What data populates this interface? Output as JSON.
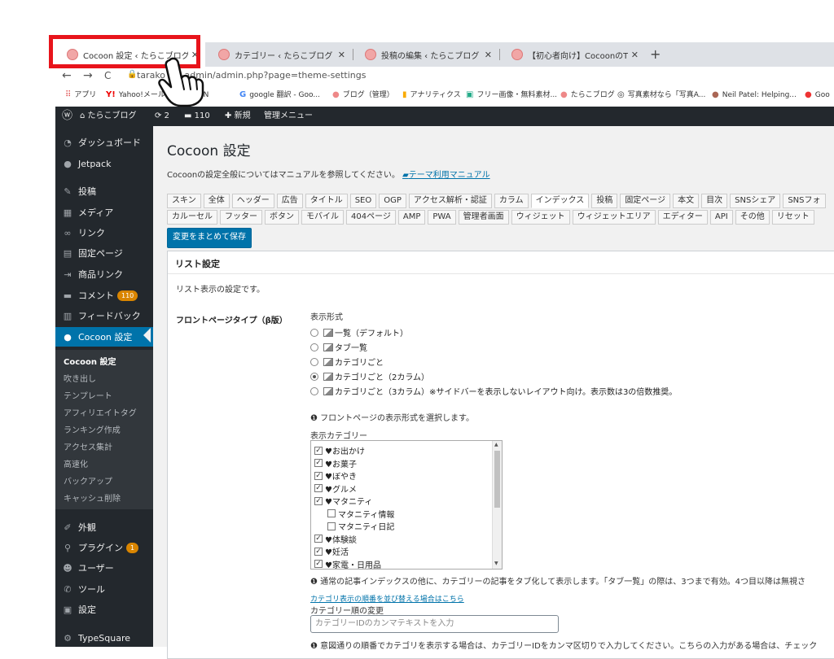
{
  "browser": {
    "tabs": [
      {
        "title": "Cocoon 設定 ‹ たらこブログ — Wor",
        "active": true
      },
      {
        "title": "カテゴリー ‹ たらこブログ — WordPre",
        "active": false
      },
      {
        "title": "投稿の編集 ‹ たらこブログ — WordP",
        "active": false
      },
      {
        "title": "【初心者向け】CocoonのTOPページ",
        "active": false
      }
    ],
    "close_glyph": "✕",
    "new_tab": "+",
    "url": "tarako        wp-admin/admin.php?page=theme-settings",
    "nav": {
      "back": "←",
      "forward": "→",
      "reload": "C"
    },
    "bookmarks": [
      {
        "icon": "apps-icon",
        "label": "アプリ"
      },
      {
        "icon": "yahoo-icon",
        "label": "Yahoo!メール"
      },
      {
        "icon": "yahoo-japan-icon",
        "label": "JAPAN"
      },
      {
        "icon": "google-icon",
        "label": "google 翻訳 - Goo..."
      },
      {
        "icon": "blog-icon",
        "label": "ブログ（管理）"
      },
      {
        "icon": "analytics-icon",
        "label": "アナリティクス"
      },
      {
        "icon": "image-icon",
        "label": "フリー画像・無料素材..."
      },
      {
        "icon": "blog-icon",
        "label": "たらこブログ"
      },
      {
        "icon": "photo-icon",
        "label": "写真素材なら「写真A..."
      },
      {
        "icon": "avatar-icon",
        "label": "Neil Patel: Helping..."
      },
      {
        "icon": "maps-icon",
        "label": "Goo"
      }
    ]
  },
  "adminbar": {
    "site": "たらこブログ",
    "updates": "2",
    "comments": "110",
    "new": "新規",
    "admin_menu": "管理メニュー"
  },
  "sidebar": {
    "items": [
      {
        "label": "ダッシュボード",
        "icon": "dashboard-icon"
      },
      {
        "label": "Jetpack",
        "icon": "jetpack-icon"
      },
      {
        "label": "投稿",
        "icon": "pin-icon"
      },
      {
        "label": "メディア",
        "icon": "media-icon"
      },
      {
        "label": "リンク",
        "icon": "link-icon"
      },
      {
        "label": "固定ページ",
        "icon": "page-icon"
      },
      {
        "label": "商品リンク",
        "icon": "product-link-icon"
      },
      {
        "label": "コメント",
        "icon": "comment-icon",
        "badge": "110"
      },
      {
        "label": "フィードバック",
        "icon": "feedback-icon"
      },
      {
        "label": "Cocoon 設定",
        "icon": "cocoon-icon",
        "current": true
      },
      {
        "label": "外観",
        "icon": "brush-icon"
      },
      {
        "label": "プラグイン",
        "icon": "plugin-icon",
        "badge": "1"
      },
      {
        "label": "ユーザー",
        "icon": "user-icon"
      },
      {
        "label": "ツール",
        "icon": "wrench-icon"
      },
      {
        "label": "設定",
        "icon": "settings-icon"
      },
      {
        "label": "TypeSquare",
        "icon": "gear-icon"
      }
    ],
    "submenu": [
      "Cocoon 設定",
      "吹き出し",
      "テンプレート",
      "アフィリエイトタグ",
      "ランキング作成",
      "アクセス集計",
      "高速化",
      "バックアップ",
      "キャッシュ削除"
    ]
  },
  "page": {
    "title": "Cocoon 設定",
    "description": "Cocoonの設定全般についてはマニュアルを参照してください。",
    "manual_link": "テーマ利用マニュアル",
    "tabs_row1": [
      "スキン",
      "全体",
      "ヘッダー",
      "広告",
      "タイトル",
      "SEO",
      "OGP",
      "アクセス解析・認証",
      "カラム",
      "インデックス",
      "投稿",
      "固定ページ",
      "本文",
      "目次",
      "SNSシェア",
      "SNSフォ"
    ],
    "tabs_row2": [
      "カルーセル",
      "フッター",
      "ボタン",
      "モバイル",
      "404ページ",
      "AMP",
      "PWA",
      "管理者画面",
      "ウィジェット",
      "ウィジェットエリア",
      "エディター",
      "API",
      "その他",
      "リセット"
    ],
    "active_tab": "インデックス",
    "save_button": "変更をまとめて保存"
  },
  "panel": {
    "title": "リスト設定",
    "intro": "リスト表示の設定です。",
    "field_label": "フロントページタイプ（β版）",
    "display_format_label": "表示形式",
    "options": [
      {
        "label": "一覧（デフォルト）",
        "checked": false
      },
      {
        "label": "タブ一覧",
        "checked": false
      },
      {
        "label": "カテゴリごと",
        "checked": false
      },
      {
        "label": "カテゴリごと（2カラム）",
        "checked": true
      },
      {
        "label": "カテゴリごと（3カラム）※サイドバーを表示しないレイアウト向け。表示数は3の倍数推奨。",
        "checked": false
      }
    ],
    "help1": "フロントページの表示形式を選択します。",
    "category_label": "表示カテゴリー",
    "categories": [
      {
        "label": "♥お出かけ",
        "checked": true,
        "indent": 0
      },
      {
        "label": "♥お菓子",
        "checked": true,
        "indent": 0
      },
      {
        "label": "♥ぼやき",
        "checked": true,
        "indent": 0
      },
      {
        "label": "♥グルメ",
        "checked": true,
        "indent": 0
      },
      {
        "label": "♥マタニティ",
        "checked": true,
        "indent": 0
      },
      {
        "label": "マタニティ情報",
        "checked": false,
        "indent": 1
      },
      {
        "label": "マタニティ日記",
        "checked": false,
        "indent": 1
      },
      {
        "label": "♥体験談",
        "checked": true,
        "indent": 0
      },
      {
        "label": "♥妊活",
        "checked": true,
        "indent": 0
      },
      {
        "label": "♥家電・日用品",
        "checked": true,
        "indent": 0
      }
    ],
    "help2": "通常の記事インデックスの他に、カテゴリーの記事をタブ化して表示します。「タブ一覧」の際は、3つまで有効。4つ目以降は無視さ",
    "order_link": "カテゴリ表示の順番を並び替える場合はこちら",
    "order_label": "カテゴリー順の変更",
    "order_placeholder": "カテゴリーIDのカンマテキストを入力",
    "help3": "意図通りの順番でカテゴリを表示する場合は、カテゴリーIDをカンマ区切りで入力してください。こちらの入力がある場合は、チェック"
  },
  "colors": {
    "highlight": "#e8141b",
    "wp_blue": "#0073aa",
    "admin_dark": "#23282d"
  }
}
